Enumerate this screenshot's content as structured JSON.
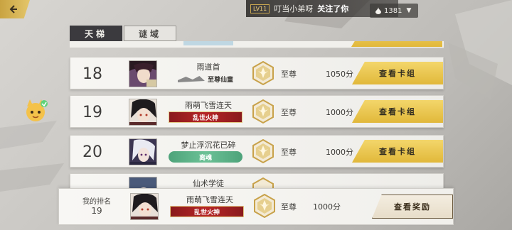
{
  "notice": {
    "level": "LV11",
    "name": "叮当小弟呀",
    "action": "关注了你"
  },
  "currency": {
    "amount": "1381"
  },
  "tabs": [
    {
      "label": "天梯",
      "active": true
    },
    {
      "label": "谜域",
      "active": false
    }
  ],
  "rows": [
    {
      "rank": "18",
      "name": "雨道首",
      "title": "至尊仙童",
      "title_style": "plain",
      "tier": "至尊",
      "score": "1050分",
      "button": "查看卡组"
    },
    {
      "rank": "19",
      "name": "雨萌飞雪连天",
      "title": "乱世火神",
      "title_style": "red",
      "tier": "至尊",
      "score": "1000分",
      "button": "查看卡组"
    },
    {
      "rank": "20",
      "name": "梦止浮沉花已碎",
      "title": "离魂",
      "title_style": "green",
      "tier": "至尊",
      "score": "1000分",
      "button": "查看卡组"
    }
  ],
  "peek_row": {
    "name": "仙术学徒"
  },
  "my_rank": {
    "label": "我的排名",
    "rank": "19",
    "name": "雨萌飞雪连天",
    "title": "乱世火神",
    "tier": "至尊",
    "score": "1000分",
    "button": "查看奖励"
  },
  "colors": {
    "gold": "#e1b83a",
    "red_tag": "#b62527",
    "green_tag": "#6cc196",
    "tab_active": "#3b3a3e"
  },
  "icons": [
    "back-arrow-icon",
    "drop-icon",
    "dropdown-caret-icon",
    "medal-icon",
    "mascot-icon"
  ]
}
